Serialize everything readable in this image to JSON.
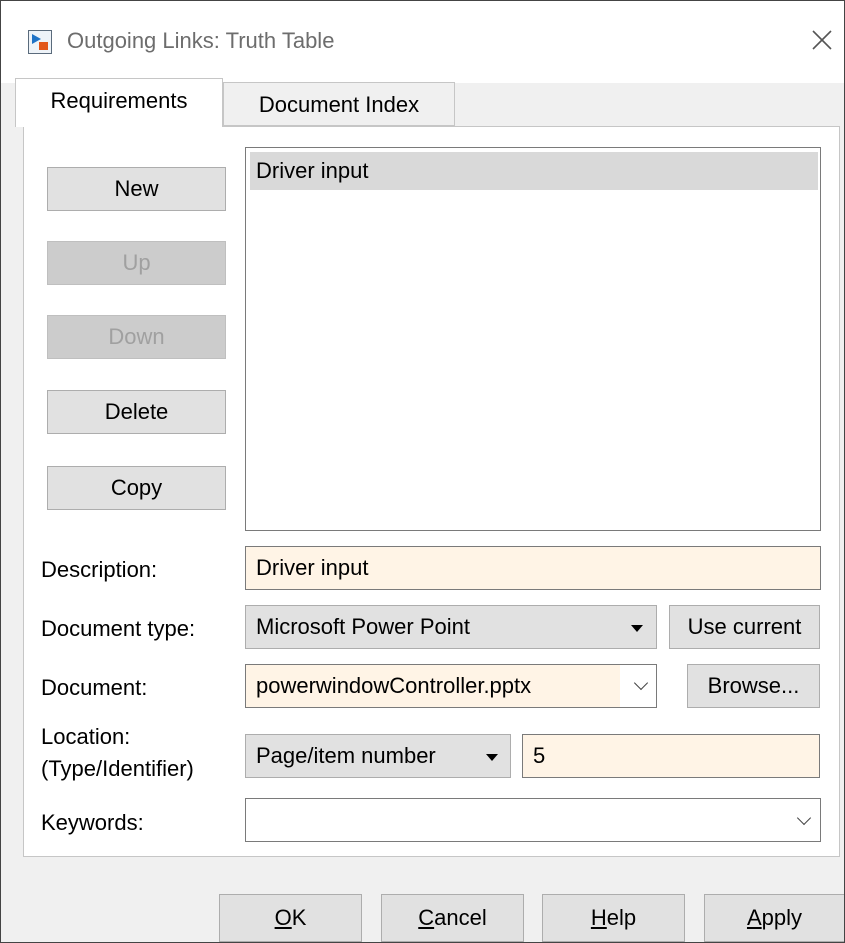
{
  "window": {
    "title": "Outgoing Links: Truth Table"
  },
  "tabs": [
    {
      "label": "Requirements",
      "active": true
    },
    {
      "label": "Document Index",
      "active": false
    }
  ],
  "side_buttons": {
    "new": "New",
    "up": "Up",
    "down": "Down",
    "delete": "Delete",
    "copy": "Copy"
  },
  "requirements_list": {
    "items": [
      "Driver input"
    ],
    "selected_index": 0
  },
  "form": {
    "description_label": "Description:",
    "description_value": "Driver input",
    "document_type_label": "Document type:",
    "document_type_value": "Microsoft Power Point",
    "use_current_label": "Use current",
    "document_label": "Document:",
    "document_value": "powerwindowController.pptx",
    "browse_label": "Browse...",
    "location_label_line1": "Location:",
    "location_label_line2": "(Type/Identifier)",
    "location_type_value": "Page/item number",
    "location_identifier_value": "5",
    "keywords_label": "Keywords:",
    "keywords_value": ""
  },
  "footer_buttons": {
    "ok_mnemonic": "O",
    "ok_rest": "K",
    "cancel_mnemonic": "C",
    "cancel_rest": "ancel",
    "help_mnemonic": "H",
    "help_rest": "elp",
    "apply_mnemonic": "A",
    "apply_rest": "pply"
  },
  "colors": {
    "editable_field_bg": "#fff4e6",
    "selection_bg": "#d9d9d9",
    "button_bg": "#e1e1e1",
    "disabled_text": "#a0a0a0"
  },
  "icons": {
    "app": "simulink-model-icon",
    "close": "close-icon",
    "dropdown": "dropdown-arrow-icon",
    "combo": "chevron-down-icon"
  }
}
